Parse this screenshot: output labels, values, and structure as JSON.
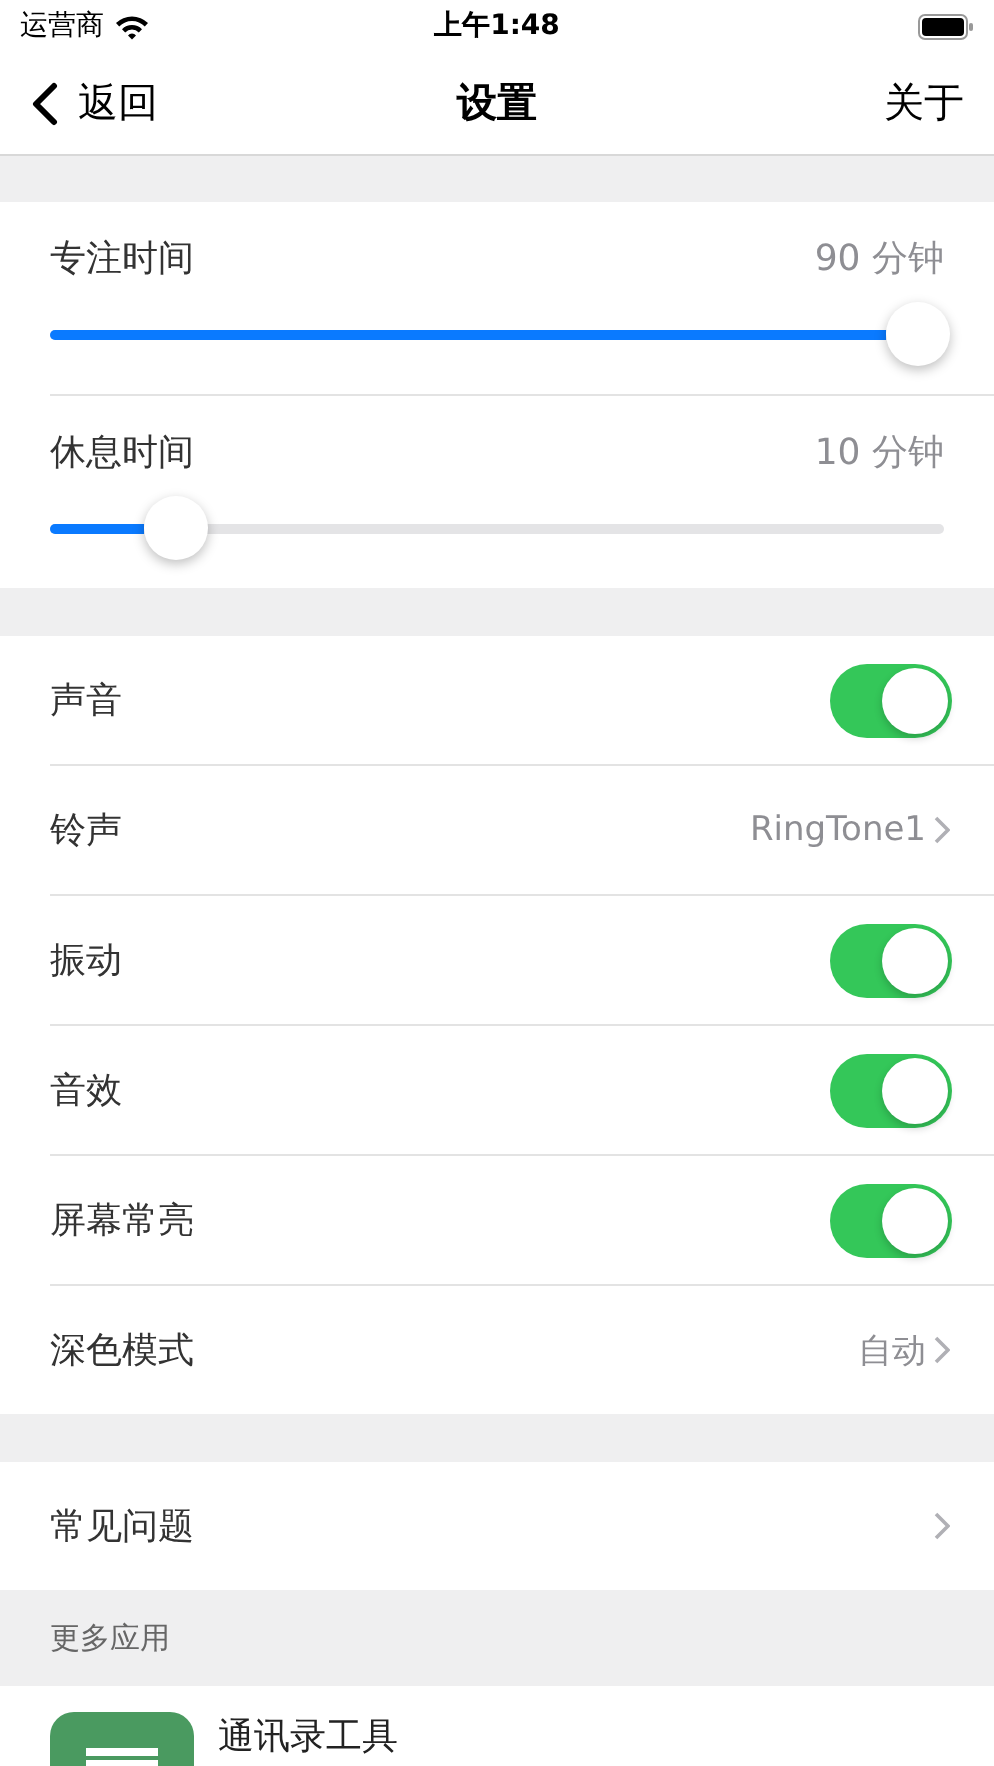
{
  "status_bar": {
    "carrier": "运营商",
    "time": "上午1:48"
  },
  "nav": {
    "back": "返回",
    "title": "设置",
    "action": "关于"
  },
  "sliders": [
    {
      "label": "专注时间",
      "reading": "90 分钟",
      "level": 0.97
    },
    {
      "label": "休息时间",
      "reading": "10 分钟",
      "level": 0.14
    }
  ],
  "settings": [
    {
      "kind": "toggle",
      "label": "声音",
      "on": true
    },
    {
      "kind": "link",
      "label": "铃声",
      "value": "RingTone1"
    },
    {
      "kind": "toggle",
      "label": "振动",
      "on": true
    },
    {
      "kind": "toggle",
      "label": "音效",
      "on": true
    },
    {
      "kind": "toggle",
      "label": "屏幕常亮",
      "on": true
    },
    {
      "kind": "link",
      "label": "深色模式",
      "value": "自动"
    }
  ],
  "help": [
    {
      "kind": "link",
      "label": "常见问题"
    }
  ],
  "more_apps": {
    "header": "更多应用",
    "apps": [
      {
        "name": "通讯录工具"
      }
    ]
  }
}
